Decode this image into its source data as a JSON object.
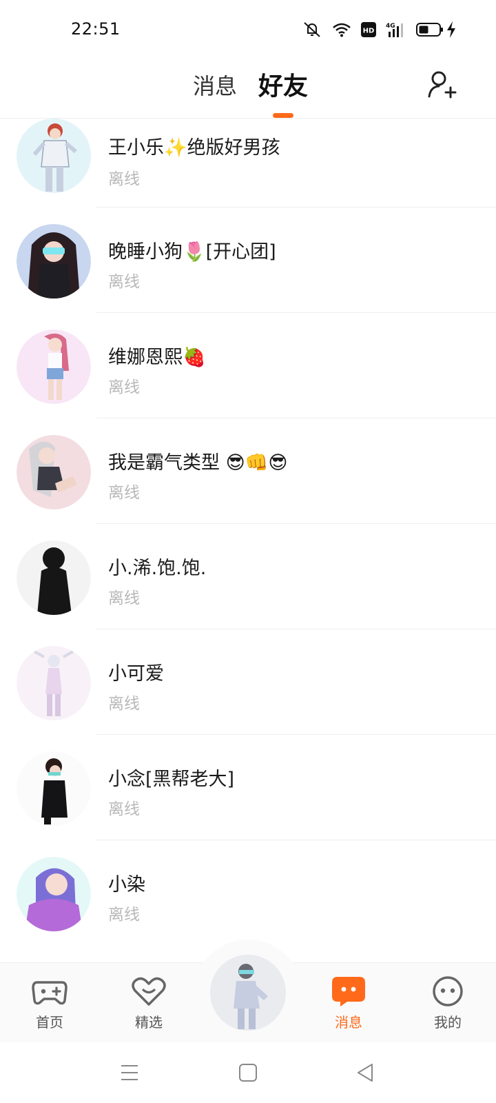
{
  "status_bar": {
    "time": "22:51",
    "icons": [
      "bell-muted-icon",
      "wifi-icon",
      "hd-icon",
      "signal-4g-icon",
      "battery-icon",
      "charging-icon"
    ],
    "hd_text": "HD",
    "network_text": "4G"
  },
  "header": {
    "tabs": [
      {
        "label": "消息",
        "active": false
      },
      {
        "label": "好友",
        "active": true
      }
    ],
    "accent_color": "#ff6a1a",
    "add_friend_icon": "add-user-icon"
  },
  "friends": [
    {
      "name": "王小乐✨绝版好男孩",
      "status": "离线"
    },
    {
      "name": "晚睡小狗🌷[开心团]",
      "status": "离线"
    },
    {
      "name": "维娜恩熙🍓",
      "status": "离线"
    },
    {
      "name": "我是霸气类型 😎👊😎",
      "status": "离线"
    },
    {
      "name": "小.浠.饱.饱.",
      "status": "离线"
    },
    {
      "name": "小可爱",
      "status": "离线"
    },
    {
      "name": "小念[黑帮老大]",
      "status": "离线"
    },
    {
      "name": "小染",
      "status": "离线"
    }
  ],
  "bottom_nav": {
    "items": [
      {
        "label": "首页",
        "icon": "gamepad-icon",
        "active": false
      },
      {
        "label": "精选",
        "icon": "heart-icon",
        "active": false
      },
      {
        "label": "消息",
        "icon": "chat-bubble-icon",
        "active": true
      },
      {
        "label": "我的",
        "icon": "face-icon",
        "active": false
      }
    ],
    "center_icon": "avatar-character-icon"
  },
  "system_nav": {
    "icons": [
      "menu-icon",
      "home-square-icon",
      "back-triangle-icon"
    ]
  }
}
